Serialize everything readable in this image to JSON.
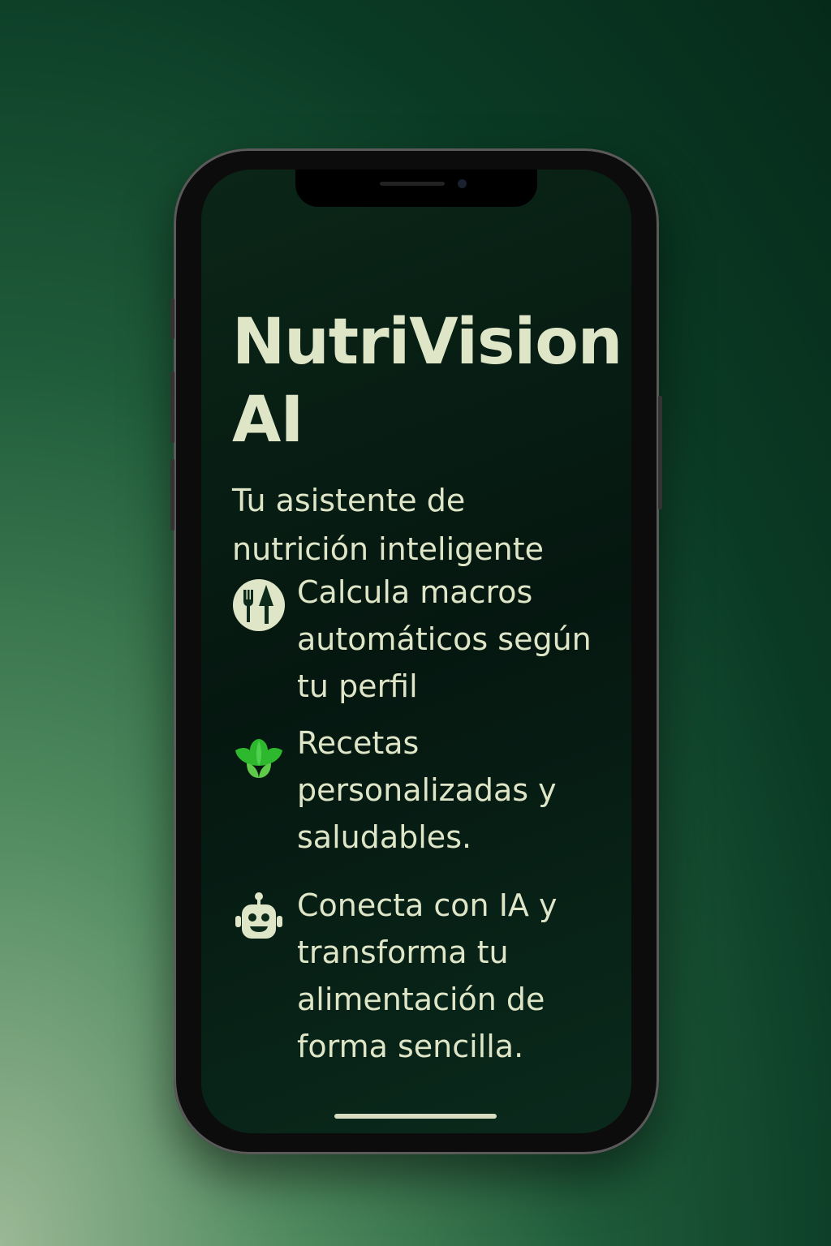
{
  "app": {
    "title": "NutriVision\nAI",
    "subtitle": "Tu asistente de\nnutrición inteligente"
  },
  "features": [
    {
      "icon": "fork-knife-icon",
      "text": "Calcula macros\nautomáticos según\ntu perfil"
    },
    {
      "icon": "lettuce-icon",
      "text": "Recetas\npersonalizadas y\nsaludables."
    },
    {
      "icon": "robot-icon",
      "text": "Conecta con IA y\ntransforma tu\nalimentación de\nforma sencilla."
    }
  ],
  "colors": {
    "text": "#dfe6c8",
    "accent": "#2eb82e",
    "background": "#051710"
  }
}
